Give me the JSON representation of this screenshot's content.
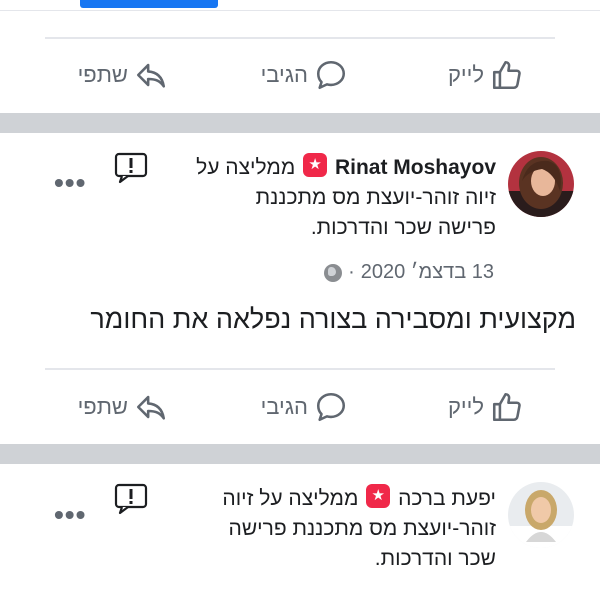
{
  "actions": {
    "like": "לייק",
    "comment": "הגיבי",
    "share": "שתפי"
  },
  "posts": [
    {
      "author": "Rinat Moshayov",
      "recommends_line1": "ממליצה על",
      "recommends_line2": "זיוה זוהר-יועצת מס מתכננת",
      "recommends_line3": "פרישה שכר והדרכות.",
      "date": "13 בדצמ׳ 2020",
      "separator": "·",
      "text": "מקצועית ומסבירה בצורה נפלאה את החומר"
    },
    {
      "author": "יפעת ברכה",
      "recommends_line1": "ממליצה על זיוה",
      "recommends_line2": "זוהר-יועצת מס מתכננת פרישה",
      "recommends_line3": "שכר והדרכות."
    }
  ],
  "colors": {
    "accent": "#1877f2",
    "recommend_badge": "#f02849",
    "muted_text": "#606770",
    "separator_band": "#cfd2d6"
  }
}
